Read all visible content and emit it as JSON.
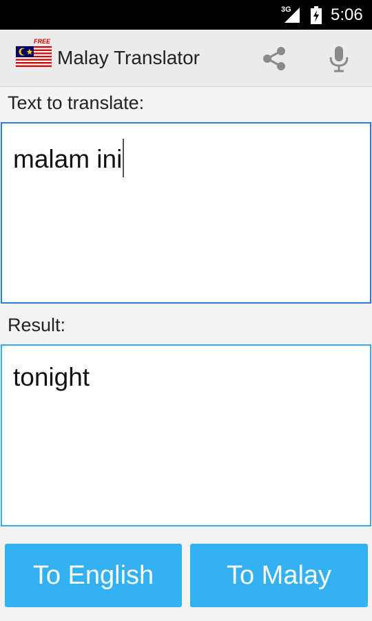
{
  "status_bar": {
    "network": "3G",
    "time": "5:06",
    "icons": [
      "signal-icon",
      "battery-charging-icon"
    ]
  },
  "app": {
    "title": "Malay Translator",
    "flag_badge": "FREE",
    "flag_icon": "malaysia-flag-icon",
    "share_icon": "share-icon",
    "mic_icon": "microphone-icon"
  },
  "input": {
    "label": "Text to translate:",
    "value": "malam ini"
  },
  "result": {
    "label": "Result:",
    "value": "tonight"
  },
  "buttons": {
    "to_english": "To English",
    "to_malay": "To Malay"
  },
  "colors": {
    "accent": "#33b1f0",
    "input_border": "#2d7bd9",
    "status_bar": "#000000",
    "action_bar": "#ebebeb"
  }
}
